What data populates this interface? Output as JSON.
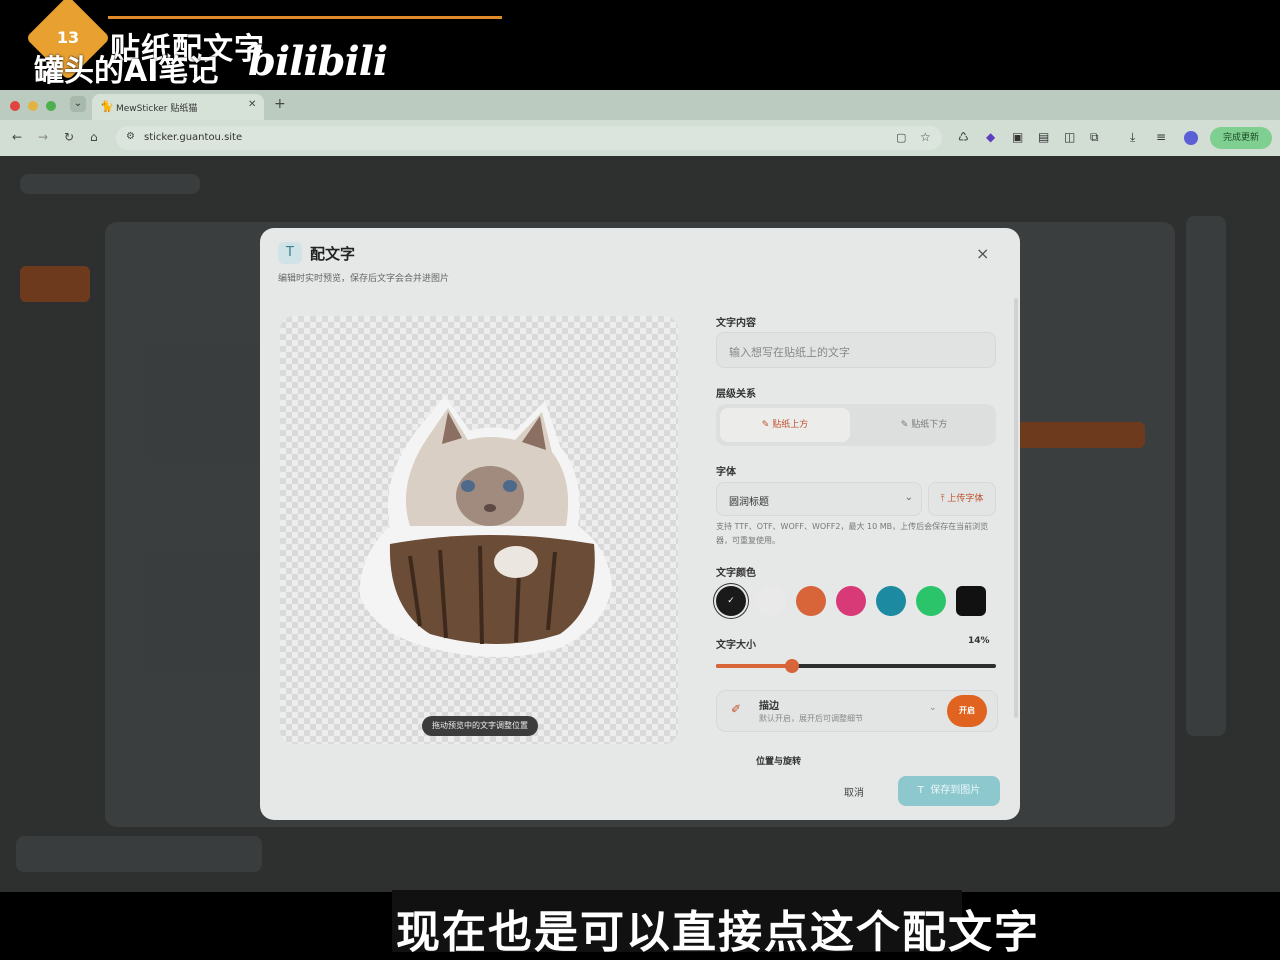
{
  "overlay": {
    "episode_number": "13",
    "episode_title": "贴纸配文字",
    "channel_name": "罐头的AI笔记",
    "platform_logo": "bilibili",
    "subtitle": "现在也是可以直接点这个配文字"
  },
  "browser": {
    "tab_title": "MewSticker 贴纸猫",
    "tab_icon": "cat-icon",
    "url": "sticker.guantou.site",
    "update_button": "完成更新",
    "traffic_light_colors": [
      "#e0443e",
      "#e3b342",
      "#4caf50"
    ]
  },
  "modal": {
    "title": "配文字",
    "title_icon": "T",
    "subtitle": "编辑时实时预览，保存后文字会合并进图片",
    "close_label": "×",
    "preview": {
      "drag_hint": "拖动预览中的文字调整位置"
    },
    "text_content": {
      "label": "文字内容",
      "placeholder": "输入想写在贴纸上的文字",
      "value": ""
    },
    "layer": {
      "label": "层级关系",
      "options": [
        "贴纸上方",
        "贴纸下方"
      ],
      "selected": "贴纸上方"
    },
    "font": {
      "label": "字体",
      "value": "圆润标题",
      "upload_label": "上传字体",
      "hint": "支持 TTF、OTF、WOFF、WOFF2，最大 10 MB，上传后会保存在当前浏览器，可重复使用。"
    },
    "text_color": {
      "label": "文字颜色",
      "swatches": [
        "#1a1a1a",
        "#e9e9e9",
        "#d8643a",
        "#d83a78",
        "#1c8aa0",
        "#2cc46a",
        "#111111"
      ],
      "selected_index": 0
    },
    "text_size": {
      "label": "文字大小",
      "value_text": "14%",
      "value": 0.27
    },
    "stroke": {
      "title": "描边",
      "description": "默认开启，展开后可调整细节",
      "toggle_label": "开启"
    },
    "more_section_label": "位置与旋转",
    "cancel_label": "取消",
    "save_label": "保存到图片",
    "save_icon": "T"
  }
}
